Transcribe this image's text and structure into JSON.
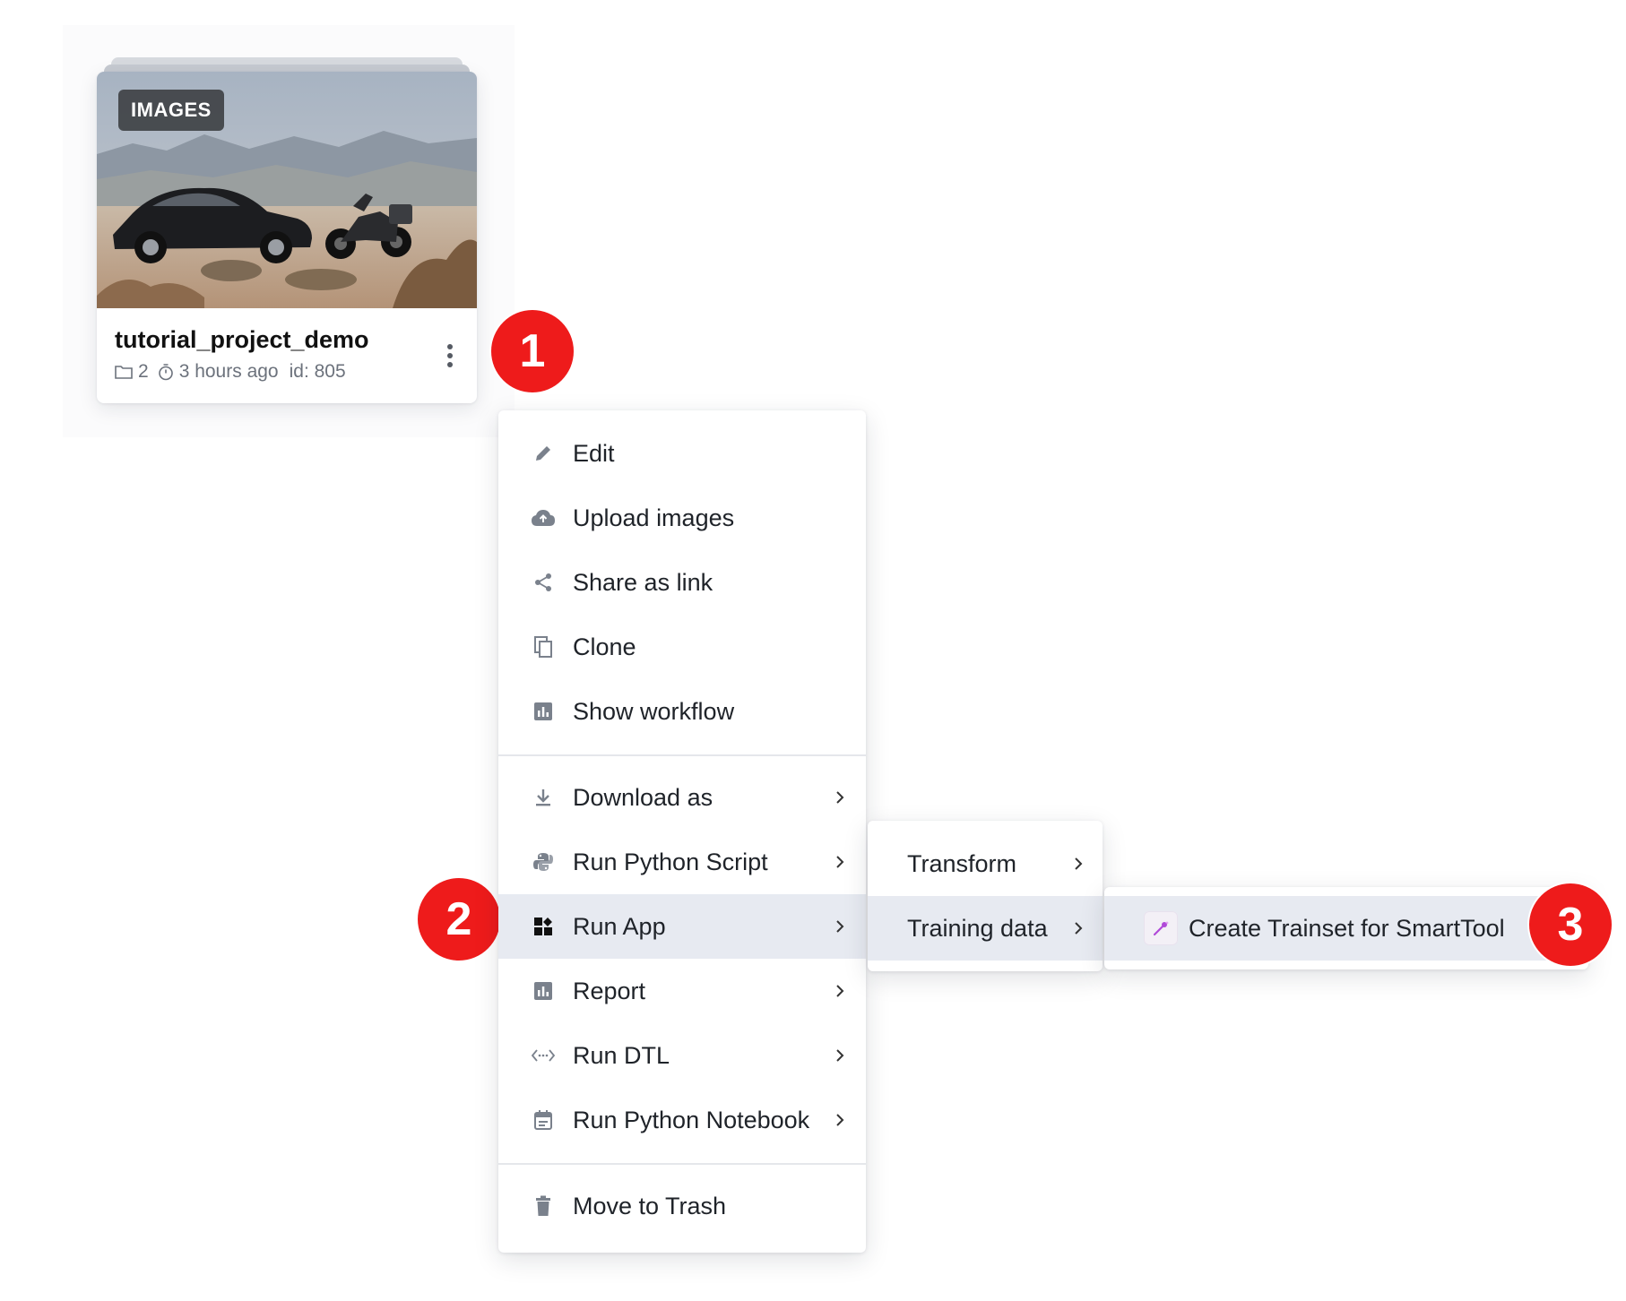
{
  "card": {
    "badge": "IMAGES",
    "title": "tutorial_project_demo",
    "datasets_count": "2",
    "time_ago": "3 hours ago",
    "id_label": "id: 805",
    "more_icon": "more-vertical-icon"
  },
  "markers": [
    "1",
    "2",
    "3"
  ],
  "main_menu": {
    "items": [
      {
        "label": "Edit",
        "icon": "pencil-icon"
      },
      {
        "label": "Upload images",
        "icon": "cloud-upload-icon"
      },
      {
        "label": "Share as link",
        "icon": "share-icon"
      },
      {
        "label": "Clone",
        "icon": "copy-icon"
      },
      {
        "label": "Show workflow",
        "icon": "chart-icon"
      },
      {
        "label": "Download as",
        "icon": "download-icon"
      },
      {
        "label": "Run Python Script",
        "icon": "python-icon"
      },
      {
        "label": "Run App",
        "icon": "apps-icon"
      },
      {
        "label": "Report",
        "icon": "report-icon"
      },
      {
        "label": "Run DTL",
        "icon": "code-icon"
      },
      {
        "label": "Run Python Notebook",
        "icon": "notebook-icon"
      },
      {
        "label": "Move to Trash",
        "icon": "trash-icon"
      }
    ]
  },
  "sub_menu": {
    "items": [
      {
        "label": "Transform"
      },
      {
        "label": "Training data"
      }
    ]
  },
  "sub2_menu": {
    "items": [
      {
        "label": "Create Trainset for SmartTool",
        "icon": "wand-icon"
      }
    ]
  },
  "colors": {
    "marker": "#ee1b1b",
    "active_bg": "#e7eaf1",
    "icon_gray": "#7a818c",
    "app_accent": "#b04ad8"
  }
}
